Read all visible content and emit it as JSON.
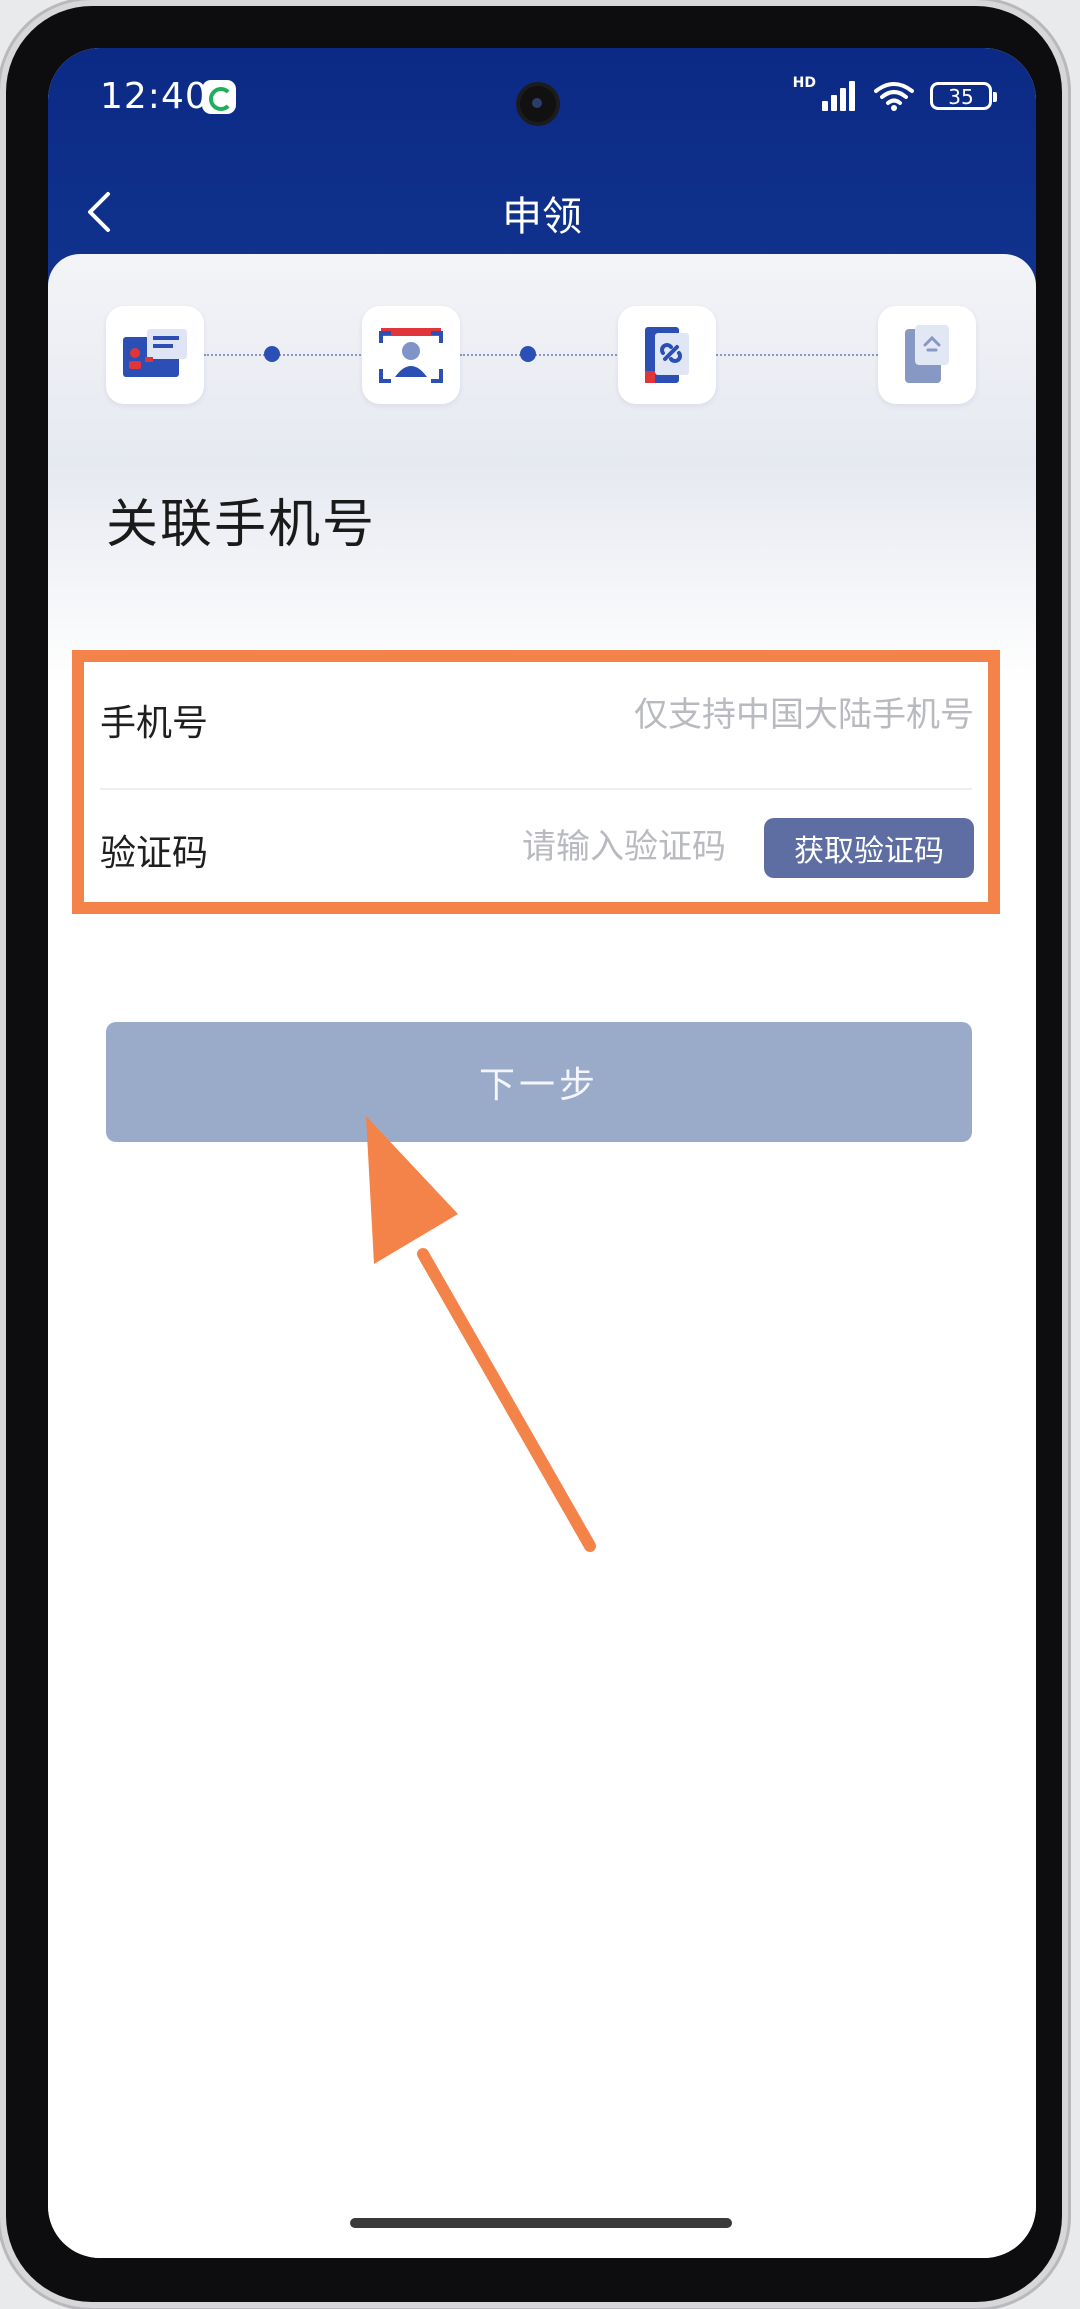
{
  "status_bar": {
    "time": "12:40",
    "network_badge": "HD",
    "battery": "35"
  },
  "nav": {
    "title": "申领"
  },
  "steps": [
    {
      "icon": "id-card-icon"
    },
    {
      "icon": "face-scan-icon"
    },
    {
      "icon": "link-device-icon"
    },
    {
      "icon": "phone-lock-icon"
    }
  ],
  "page": {
    "title": "关联手机号"
  },
  "form": {
    "phone_label": "手机号",
    "phone_placeholder": "仅支持中国大陆手机号",
    "code_label": "验证码",
    "code_placeholder": "请输入验证码",
    "get_code_label": "获取验证码"
  },
  "actions": {
    "next_label": "下一步"
  },
  "colors": {
    "header": "#0b2a86",
    "highlight": "#f4834a",
    "primary_disabled": "#9aabc9",
    "code_button": "#5e6ea2"
  }
}
